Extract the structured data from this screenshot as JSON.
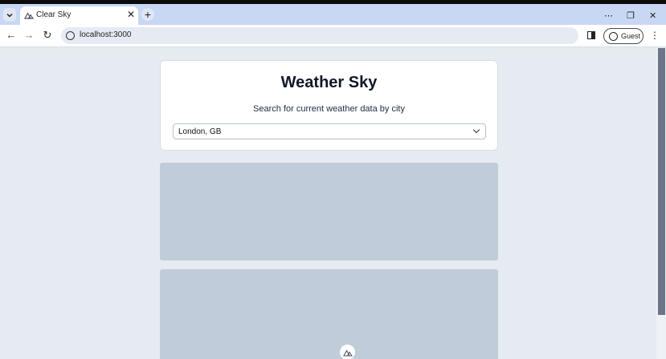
{
  "browser": {
    "tab_title": "Clear Sky",
    "url": "localhost:3000",
    "profile_label": "Guest",
    "accent_color": "#c8d7f3"
  },
  "page": {
    "title": "Weather Sky",
    "subtitle": "Search for current weather data by city",
    "city_select": {
      "value": "London, GB"
    }
  },
  "icons": [
    "tab-search-icon",
    "nuxt-logo-icon",
    "close-icon",
    "plus-icon",
    "minimize-icon",
    "restore-icon",
    "close-window-icon",
    "back-arrow-icon",
    "forward-arrow-icon",
    "reload-icon",
    "site-info-icon",
    "side-panel-icon",
    "profile-icon",
    "more-menu-icon",
    "chevron-down-icon"
  ]
}
